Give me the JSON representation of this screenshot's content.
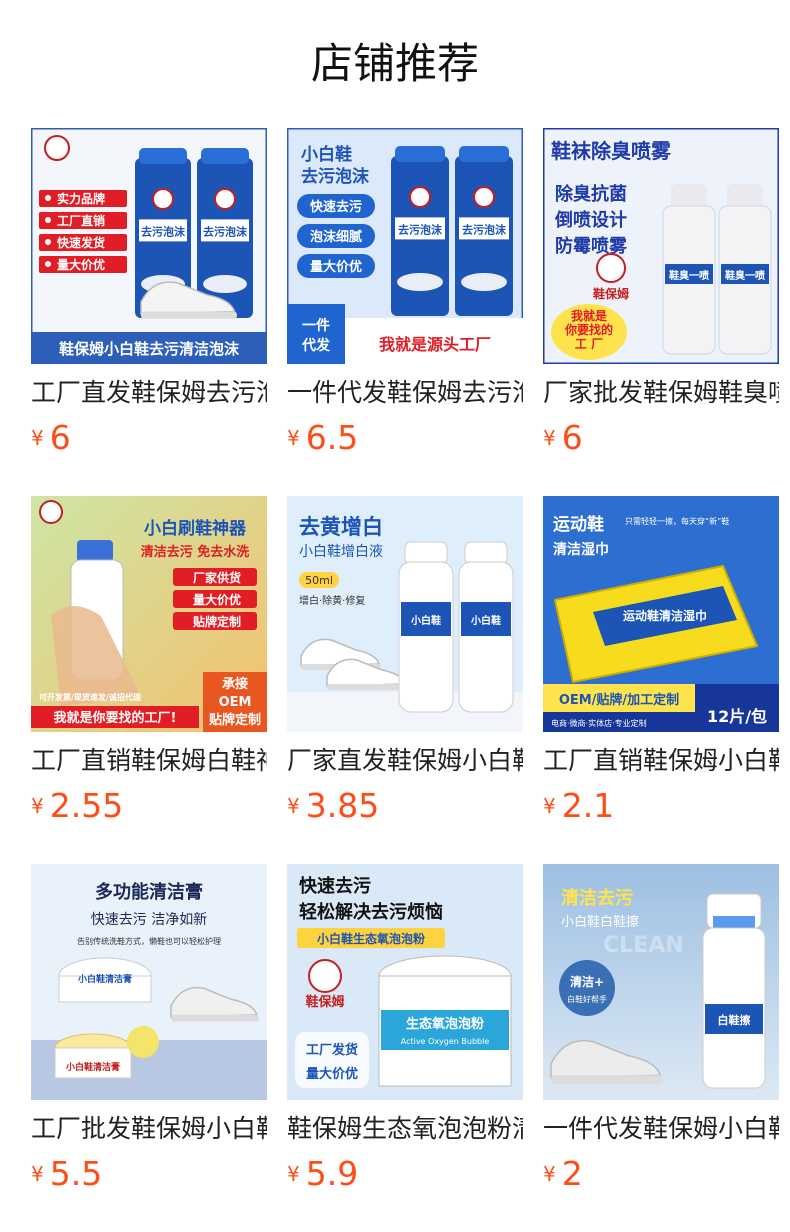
{
  "title": "店铺推荐",
  "currency": "¥",
  "products": [
    {
      "name": "工厂直发鞋保姆去污泡沫",
      "price": "6",
      "img": {
        "theme": "foam",
        "texts": [
          "实力品牌",
          "工厂直销",
          "快速发货",
          "量大价优"
        ],
        "banner": "鞋保姆小白鞋去污清洁泡沫",
        "can_label": "去污泡沫"
      }
    },
    {
      "name": "一件代发鞋保姆去污泡沫",
      "price": "6.5",
      "img": {
        "theme": "foam2",
        "headline": "小白鞋",
        "headline2": "去污泡沫",
        "texts": [
          "快速去污",
          "泡沫细腻",
          "量大价优"
        ],
        "corner": "一件代发",
        "banner": "我就是源头工厂",
        "can_label": "去污泡沫"
      }
    },
    {
      "name": "厂家批发鞋保姆鞋臭喷雾",
      "price": "6",
      "img": {
        "theme": "spray",
        "headline": "鞋袜除臭喷雾",
        "texts": [
          "除臭抗菌",
          "倒喷设计",
          "防霉喷雾"
        ],
        "stamp": [
          "我就是",
          "你要找的",
          "工 厂"
        ],
        "brand": "鞋保姆",
        "can_label": "鞋臭一喷净"
      }
    },
    {
      "name": "工厂直销鞋保姆白鞋神器",
      "price": "2.55",
      "img": {
        "theme": "brush",
        "headline": "小白刷鞋神器",
        "subline": "清洁去污 免去水洗",
        "texts": [
          "厂家供货",
          "量大价优",
          "贴牌定制"
        ],
        "small": "可开发票/现货速发/诚招代理",
        "banner": "我就是你要找的工厂!",
        "corner": [
          "承接",
          "OEM",
          "贴牌定制"
        ],
        "brand": "鞋保姆"
      }
    },
    {
      "name": "厂家直发鞋保姆小白鞋增白液",
      "price": "3.85",
      "img": {
        "theme": "whitener",
        "headline": "去黄增白",
        "subline": "小白鞋增白液",
        "tag": "50ml",
        "small": "增白·除黄·修复",
        "bottle_label": "小白鞋增白剂"
      }
    },
    {
      "name": "工厂直销鞋保姆小白鞋湿巾",
      "price": "2.1",
      "img": {
        "theme": "wipes",
        "headline": "运动鞋",
        "subline": "清洁湿巾",
        "top_small": "只需轻轻一擦，每天穿“新”鞋",
        "pack_label": "运动鞋清洁湿巾",
        "banner": "OEM/贴牌/加工定制",
        "small": "电商·微商·实体店·专业定制",
        "count": "12片/包"
      }
    },
    {
      "name": "工厂批发鞋保姆小白鞋清洁膏",
      "price": "5.5",
      "img": {
        "theme": "paste",
        "headline": "多功能清洁膏",
        "subline": "快速去污 洁净如新",
        "small": "告别传统洗鞋方式，懒鞋也可以轻松护理",
        "jar_label": "小白鞋清洁膏",
        "jar_label2": "小白鞋清洁膏"
      }
    },
    {
      "name": "鞋保姆生态氧泡泡粉清洁剂",
      "price": "5.9",
      "img": {
        "theme": "oxygen",
        "headline": "快速去污",
        "headline2": "轻松解决去污烦恼",
        "band": "小白鞋生态氧泡泡粉",
        "brand": "鞋保姆",
        "texts": [
          "工厂发货",
          "量大价优"
        ],
        "tub_label": "生态氧泡泡粉",
        "tub_label2": "Active Oxygen Bubble"
      }
    },
    {
      "name": "一件代发鞋保姆小白鞋擦",
      "price": "2",
      "img": {
        "theme": "eraser",
        "headline": "清洁去污",
        "subline": "小白鞋白鞋擦",
        "watermark": "CLEAN",
        "badge": [
          "清洁+",
          "白鞋好帮手"
        ],
        "bottle_label": "白鞋擦"
      }
    }
  ],
  "colors": {
    "price": "#ff4d1a",
    "title": "#111111",
    "name": "#222222"
  }
}
